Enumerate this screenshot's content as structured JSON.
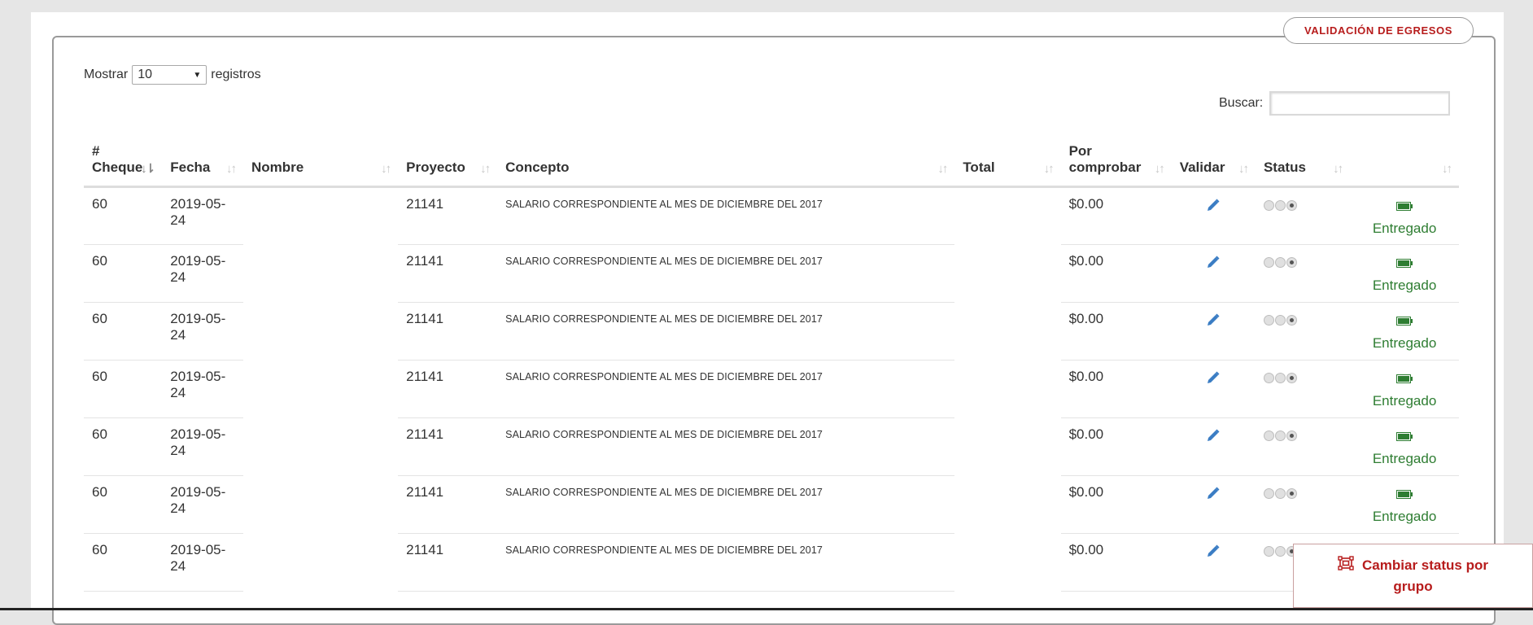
{
  "panel": {
    "tab_label": "VALIDACIÓN DE EGRESOS"
  },
  "length_control": {
    "prefix": "Mostrar",
    "selected": "10",
    "suffix": "registros"
  },
  "search": {
    "label": "Buscar:",
    "value": ""
  },
  "table": {
    "columns": [
      {
        "key": "cheque",
        "label": "# Cheque"
      },
      {
        "key": "fecha",
        "label": "Fecha"
      },
      {
        "key": "nombre",
        "label": "Nombre"
      },
      {
        "key": "proyecto",
        "label": "Proyecto"
      },
      {
        "key": "concepto",
        "label": "Concepto"
      },
      {
        "key": "total",
        "label": "Total"
      },
      {
        "key": "por_comprobar",
        "label": "Por comprobar"
      },
      {
        "key": "validar",
        "label": "Validar"
      },
      {
        "key": "status",
        "label": "Status"
      },
      {
        "key": "entregado",
        "label": ""
      }
    ],
    "header": {
      "cheque_line1": "#",
      "cheque_line2": "Cheque",
      "fecha": "Fecha",
      "nombre": "Nombre",
      "proyecto": "Proyecto",
      "concepto": "Concepto",
      "total": "Total",
      "por_comprobar_line1": "Por",
      "por_comprobar_line2": "comprobar",
      "validar": "Validar",
      "status": "Status"
    },
    "rows": [
      {
        "cheque": "60",
        "fecha_line1": "2019-05-",
        "fecha_line2": "24",
        "nombre": "",
        "proyecto": "21141",
        "concepto": "SALARIO CORRESPONDIENTE AL MES DE DICIEMBRE DEL 2017",
        "total": "",
        "por_comprobar": "$0.00",
        "status_level": 3,
        "estado": "Entregado"
      },
      {
        "cheque": "60",
        "fecha_line1": "2019-05-",
        "fecha_line2": "24",
        "nombre": "",
        "proyecto": "21141",
        "concepto": "SALARIO CORRESPONDIENTE AL MES DE DICIEMBRE DEL 2017",
        "total": "",
        "por_comprobar": "$0.00",
        "status_level": 3,
        "estado": "Entregado"
      },
      {
        "cheque": "60",
        "fecha_line1": "2019-05-",
        "fecha_line2": "24",
        "nombre": "",
        "proyecto": "21141",
        "concepto": "SALARIO CORRESPONDIENTE AL MES DE DICIEMBRE DEL 2017",
        "total": "",
        "por_comprobar": "$0.00",
        "status_level": 3,
        "estado": "Entregado"
      },
      {
        "cheque": "60",
        "fecha_line1": "2019-05-",
        "fecha_line2": "24",
        "nombre": "",
        "proyecto": "21141",
        "concepto": "SALARIO CORRESPONDIENTE AL MES DE DICIEMBRE DEL 2017",
        "total": "",
        "por_comprobar": "$0.00",
        "status_level": 3,
        "estado": "Entregado"
      },
      {
        "cheque": "60",
        "fecha_line1": "2019-05-",
        "fecha_line2": "24",
        "nombre": "",
        "proyecto": "21141",
        "concepto": "SALARIO CORRESPONDIENTE AL MES DE DICIEMBRE DEL 2017",
        "total": "",
        "por_comprobar": "$0.00",
        "status_level": 3,
        "estado": "Entregado"
      },
      {
        "cheque": "60",
        "fecha_line1": "2019-05-",
        "fecha_line2": "24",
        "nombre": "",
        "proyecto": "21141",
        "concepto": "SALARIO CORRESPONDIENTE AL MES DE DICIEMBRE DEL 2017",
        "total": "",
        "por_comprobar": "$0.00",
        "status_level": 3,
        "estado": "Entregado"
      },
      {
        "cheque": "60",
        "fecha_line1": "2019-05-",
        "fecha_line2": "24",
        "nombre": "",
        "proyecto": "21141",
        "concepto": "SALARIO CORRESPONDIENTE AL MES DE DICIEMBRE DEL 2017",
        "total": "",
        "por_comprobar": "$0.00",
        "status_level": 3,
        "estado": ""
      }
    ]
  },
  "group_button": {
    "label_line1": "Cambiar status por",
    "label_line2": "grupo",
    "icon": "select-group-icon"
  },
  "colors": {
    "accent_red": "#b71c1c",
    "delivered_green": "#2e7d32",
    "pencil_blue": "#3b7dc4",
    "battery_green": "#2e7d32"
  },
  "icons": {
    "edit": "pencil-icon",
    "status": "three-dot-status-icon",
    "delivered": "battery-icon",
    "sort": "sort-arrows-icon"
  }
}
